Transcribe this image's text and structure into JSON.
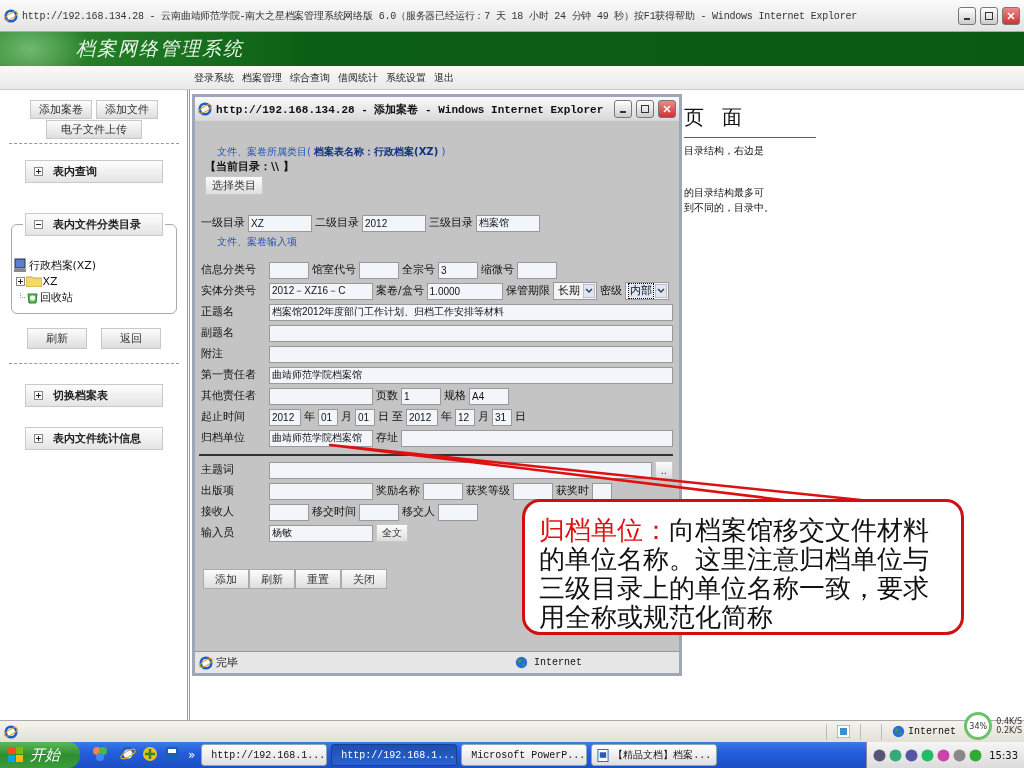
{
  "window": {
    "title": "http://192.168.134.28 - 云南曲靖师范学院-南大之星档案管理系统网络版 6.0（服务器已经运行：7 天 18 小时 24 分钟 49 秒）按F1获得帮助 - Windows Internet Explorer"
  },
  "header": {
    "title": "档案网络管理系统"
  },
  "nav": [
    "登录系统",
    "档案管理",
    "综合查询",
    "借阅统计",
    "系统设置",
    "退出"
  ],
  "sidebar": {
    "add_buttons": [
      "添加案卷",
      "添加文件"
    ],
    "upload_button": "电子文件上传",
    "panels": [
      {
        "title": "表内查询",
        "expanded": false
      },
      {
        "title": "表内文件分类目录",
        "expanded": true,
        "tree": {
          "label": "行政档案(XZ)",
          "children": [
            {
              "label": "XZ",
              "kind": "folder",
              "expanded": false
            },
            {
              "label": "回收站",
              "kind": "recycle"
            }
          ]
        },
        "buttons": [
          "刷新",
          "返回"
        ]
      },
      {
        "title": "切换档案表",
        "expanded": false
      },
      {
        "title": "表内文件统计信息",
        "expanded": false
      }
    ]
  },
  "content": {
    "heading": "页 面",
    "lines": [
      "目录结构，右边是",
      "的目录结构最多可",
      "到不同的，目录中。"
    ]
  },
  "dialog": {
    "title": "http://192.168.134.28 - 添加案卷 - Windows Internet Explorer",
    "category": "文件、案卷所属类目( **档案表名称：行政档案(XZ)** )",
    "current_dir": "【当前目录：\\\\ 】",
    "choose_button": "选择类目",
    "levels": [
      {
        "label": "一级目录",
        "value": "XZ"
      },
      {
        "label": "二级目录",
        "value": "2012"
      },
      {
        "label": "三级目录",
        "value": "档案馆"
      }
    ],
    "section": "文件、案卷输入项",
    "rows": [
      {
        "fields": [
          {
            "kind": "short",
            "label": "信息分类号"
          },
          {
            "kind": "short",
            "label": "馆室代号"
          },
          {
            "kind": "short",
            "label": "全宗号",
            "value": "3"
          },
          {
            "kind": "short",
            "label": "缩微号"
          }
        ]
      },
      {
        "fields": [
          {
            "kind": "long",
            "label": "实体分类号",
            "value": "2012－XZ16－C"
          },
          {
            "kind": "medium",
            "label": "案卷/盒号",
            "value": "1.0000"
          },
          {
            "kind": "select",
            "label": "保管期限",
            "value": "长期",
            "focused": false
          },
          {
            "kind": "select",
            "label": "密级",
            "value": "内部",
            "focused": true
          }
        ]
      },
      {
        "fields": [
          {
            "kind": "wide",
            "label": "正题名",
            "value": "档案馆2012年度部门工作计划、归档工作安排等材料"
          }
        ]
      },
      {
        "fields": [
          {
            "kind": "wide",
            "label": "副题名"
          }
        ]
      },
      {
        "fields": [
          {
            "kind": "wide",
            "label": "附注"
          }
        ]
      },
      {
        "fields": [
          {
            "kind": "wide",
            "label": "第一责任者",
            "value": "曲靖师范学院档案馆"
          }
        ]
      },
      {
        "fields": [
          {
            "kind": "long",
            "label": "其他责任者"
          },
          {
            "kind": "short",
            "label": "页数",
            "value": "1"
          },
          {
            "kind": "short",
            "label": "规格",
            "value": "A4"
          }
        ]
      },
      {
        "fields": [
          {
            "kind": "year",
            "label": "起止时间",
            "value": "2012"
          },
          {
            "kind": "tiny",
            "label": "年",
            "value": "01"
          },
          {
            "kind": "tiny",
            "label": "月",
            "value": "01"
          },
          {
            "kind": "note",
            "label": "日"
          },
          {
            "kind": "year",
            "label": "至",
            "value": "2012"
          },
          {
            "kind": "tiny",
            "label": "年",
            "value": "12"
          },
          {
            "kind": "tiny",
            "label": "月",
            "value": "31"
          },
          {
            "kind": "note",
            "label": "日"
          }
        ]
      },
      {
        "fields": [
          {
            "kind": "long",
            "label": "归档单位",
            "value": "曲靖师范学院档案馆"
          },
          {
            "kind": "wide",
            "label": "存址"
          }
        ]
      }
    ],
    "extra_rows": [
      {
        "fields": [
          {
            "kind": "wide",
            "label": "主题词"
          },
          {
            "kind": "button",
            "label": ".."
          }
        ]
      },
      {
        "fields": [
          {
            "kind": "long",
            "label": "出版项"
          },
          {
            "kind": "short",
            "label": "奖励名称"
          },
          {
            "kind": "short",
            "label": "获奖等级"
          },
          {
            "kind": "tiny",
            "label": "获奖时"
          }
        ]
      },
      {
        "fields": [
          {
            "kind": "short",
            "label": "接收人"
          },
          {
            "kind": "short",
            "label": "移交时间"
          },
          {
            "kind": "short",
            "label": "移交人"
          }
        ]
      },
      {
        "fields": [
          {
            "kind": "long",
            "label": "输入员",
            "value": "杨敏"
          },
          {
            "kind": "button",
            "label": "全文"
          }
        ]
      }
    ],
    "buttons": [
      "添加",
      "刷新",
      "重置",
      "关闭"
    ],
    "status": "完毕",
    "zone": "Internet"
  },
  "callout": {
    "term": "归档单位：",
    "text": "向档案馆移交文件材料的单位名称。这里注意归档单位与三级目录上的单位名称一致，要求用全称或规范化简称"
  },
  "status_bar": {
    "zone": "Internet",
    "network": {
      "percent": "34%",
      "up": "0.4K/S",
      "down": "0.2K/S"
    }
  },
  "taskbar": {
    "start": "开始",
    "more": "»",
    "tasks": [
      {
        "label": "http://192.168.1...",
        "selected": false,
        "kind": "browser"
      },
      {
        "label": "http://192.168.1...",
        "selected": true,
        "kind": "browser"
      },
      {
        "label": "Microsoft PowerP...",
        "selected": false,
        "kind": "slides"
      },
      {
        "label": "【精品文档】档案...",
        "selected": false,
        "kind": "document"
      }
    ],
    "clock": "15:33"
  }
}
